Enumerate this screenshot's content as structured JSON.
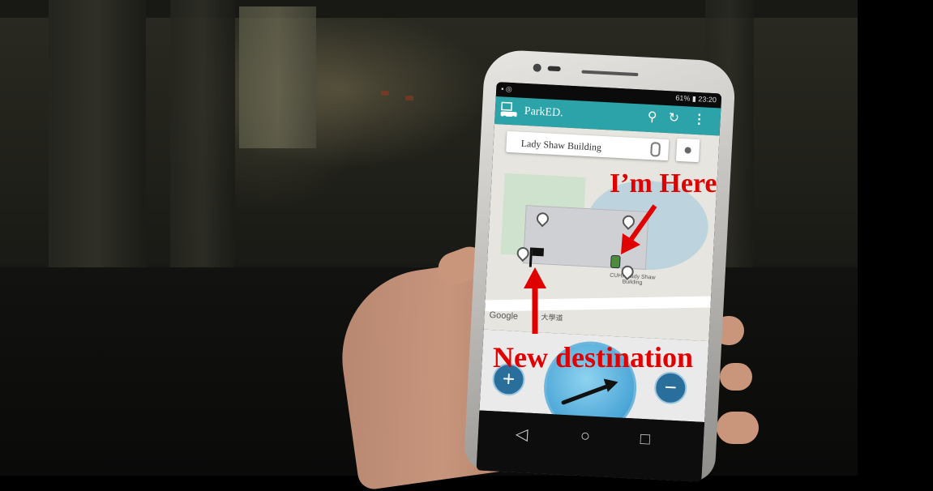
{
  "annotations": {
    "im_here": "I’m Here",
    "new_destination": "New destination"
  },
  "app": {
    "title": "ParkED.",
    "search_text": "Lady Shaw Building",
    "google_label": "Google",
    "map_labels": {
      "building": "CUHK Lady Shaw Building",
      "road": "大學道"
    },
    "status": {
      "battery": "61%",
      "time": "23:20"
    },
    "zoom_in": "+",
    "zoom_out": "−"
  },
  "navbar": {
    "back": "◁",
    "home": "○",
    "recent": "□"
  },
  "colors": {
    "annotation_red": "#e00000",
    "app_teal": "#2ba3a8",
    "compass_blue": "#4aa5d6"
  }
}
